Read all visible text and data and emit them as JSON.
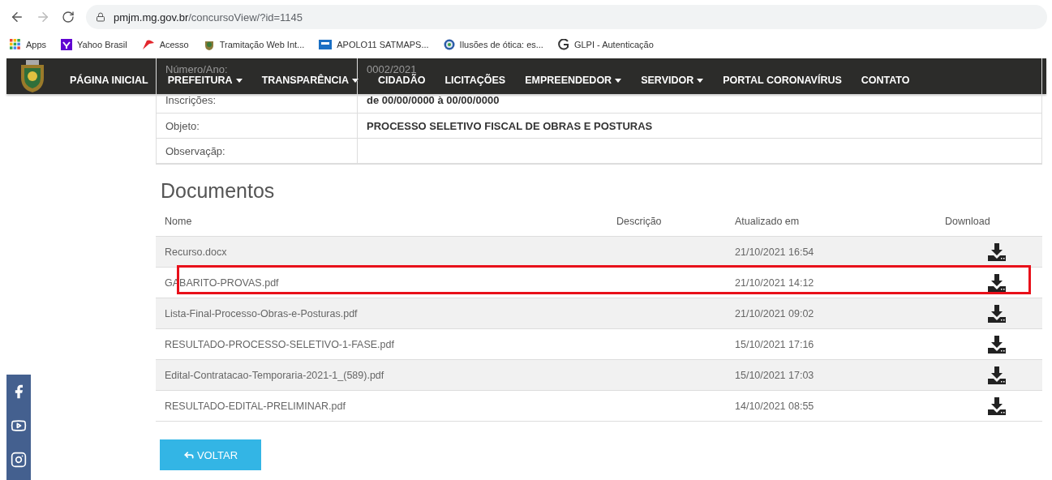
{
  "browser": {
    "url_host": "pmjm.mg.gov.br",
    "url_path": "/concursoView/?id=1145",
    "bookmarks": [
      {
        "label": "Apps",
        "kind": "apps"
      },
      {
        "label": "Yahoo Brasil",
        "kind": "yahoo"
      },
      {
        "label": "Acesso",
        "kind": "acesso"
      },
      {
        "label": "Tramitação Web Int...",
        "kind": "crest"
      },
      {
        "label": "APOLO11 SATMAPS...",
        "kind": "apolo"
      },
      {
        "label": "Ilusões de ótica: es...",
        "kind": "globe"
      },
      {
        "label": "GLPI - Autenticação",
        "kind": "glpi"
      }
    ]
  },
  "nav": {
    "items": [
      {
        "label": "PÁGINA INICIAL",
        "dropdown": false
      },
      {
        "label": "PREFEITURA",
        "dropdown": true
      },
      {
        "label": "TRANSPARÊNCIA",
        "dropdown": true
      },
      {
        "label": "CIDADÃO",
        "dropdown": false
      },
      {
        "label": "LICITAÇÕES",
        "dropdown": false
      },
      {
        "label": "EMPREENDEDOR",
        "dropdown": true
      },
      {
        "label": "SERVIDOR",
        "dropdown": true
      },
      {
        "label": "PORTAL CORONAVÍRUS",
        "dropdown": false
      },
      {
        "label": "CONTATO",
        "dropdown": false
      }
    ]
  },
  "info": [
    {
      "label": "Número/Ano:",
      "value": "0002/2021",
      "bold": false
    },
    {
      "label": "Inscrições:",
      "value": "de 00/00/0000 à 00/00/0000",
      "bold": true
    },
    {
      "label": "Objeto:",
      "value": "PROCESSO SELETIVO FISCAL DE OBRAS E POSTURAS",
      "bold": true
    },
    {
      "label": "Observaçãp:"
    }
  ],
  "documents": {
    "title": "Documentos",
    "columns": [
      "Nome",
      "Descrição",
      "Atualizado em",
      "Download"
    ],
    "rows": [
      {
        "name": "Recurso.docx",
        "updated": "21/10/2021 16:54",
        "highlighted": false
      },
      {
        "name": "GABARITO-PROVAS.pdf",
        "updated": "21/10/2021 14:12",
        "highlighted": true
      },
      {
        "name": "Lista-Final-Processo-Obras-e-Posturas.pdf",
        "updated": "21/10/2021 09:02",
        "highlighted": false
      },
      {
        "name": "RESULTADO-PROCESSO-SELETIVO-1-FASE.pdf",
        "updated": "15/10/2021 17:16",
        "highlighted": false
      },
      {
        "name": "Edital-Contratacao-Temporaria-2021-1_(589).pdf",
        "updated": "15/10/2021 17:03",
        "highlighted": false
      },
      {
        "name": "RESULTADO-EDITAL-PRELIMINAR.pdf",
        "updated": "14/10/2021 08:55",
        "highlighted": false
      }
    ]
  },
  "back_button": "VOLTAR",
  "social": [
    {
      "kind": "facebook"
    },
    {
      "kind": "youtube"
    },
    {
      "kind": "instagram"
    }
  ]
}
